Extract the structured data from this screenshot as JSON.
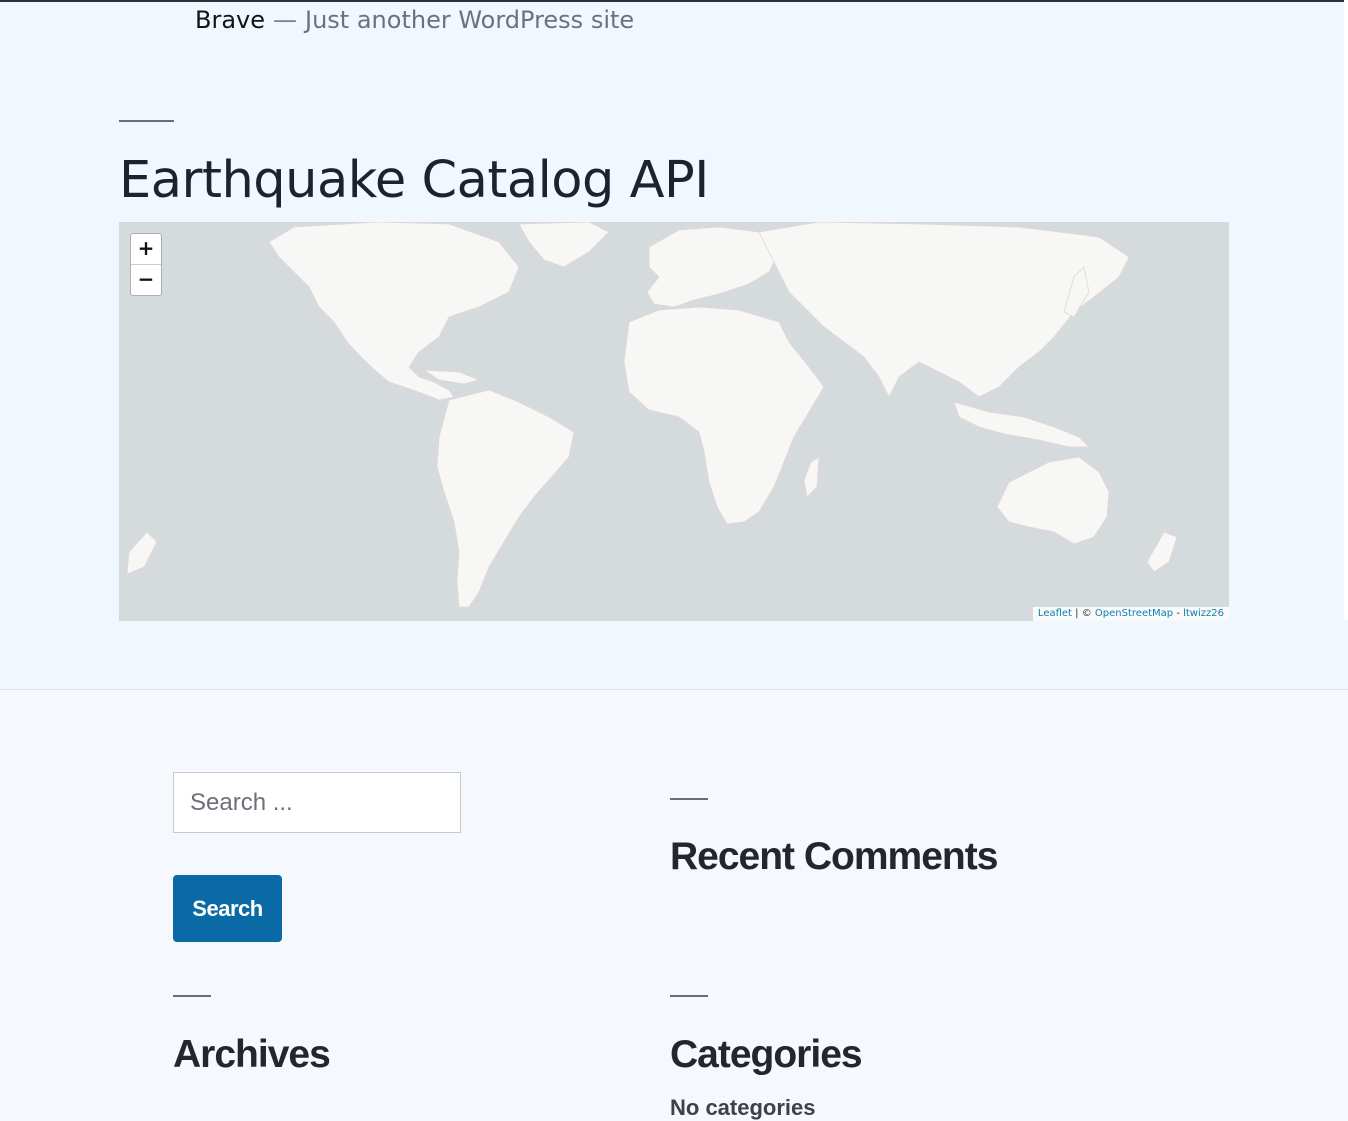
{
  "site": {
    "title": "Brave",
    "separator": "—",
    "description": "Just another WordPress site"
  },
  "page": {
    "title": "Earthquake Catalog API"
  },
  "map": {
    "zoom_in": "+",
    "zoom_out": "−",
    "attribution": {
      "leaflet": "Leaflet",
      "divider": "| ©",
      "osm": "OpenStreetMap",
      "dash": "-",
      "author": "ltwizz26"
    },
    "colors": {
      "water": "#d5dbdc",
      "land": "#f7f7f6",
      "borders": "#e7d3d6"
    }
  },
  "footer": {
    "search": {
      "placeholder": "Search ...",
      "button": "Search"
    },
    "widgets": {
      "recent_comments": "Recent Comments",
      "archives": "Archives",
      "categories": "Categories",
      "no_categories": "No categories"
    }
  },
  "colors": {
    "page_bg": "#f0f7fe",
    "footer_bg": "#f5f9fd",
    "button_bg": "#0a6aa6",
    "link": "#0c7fb0"
  }
}
